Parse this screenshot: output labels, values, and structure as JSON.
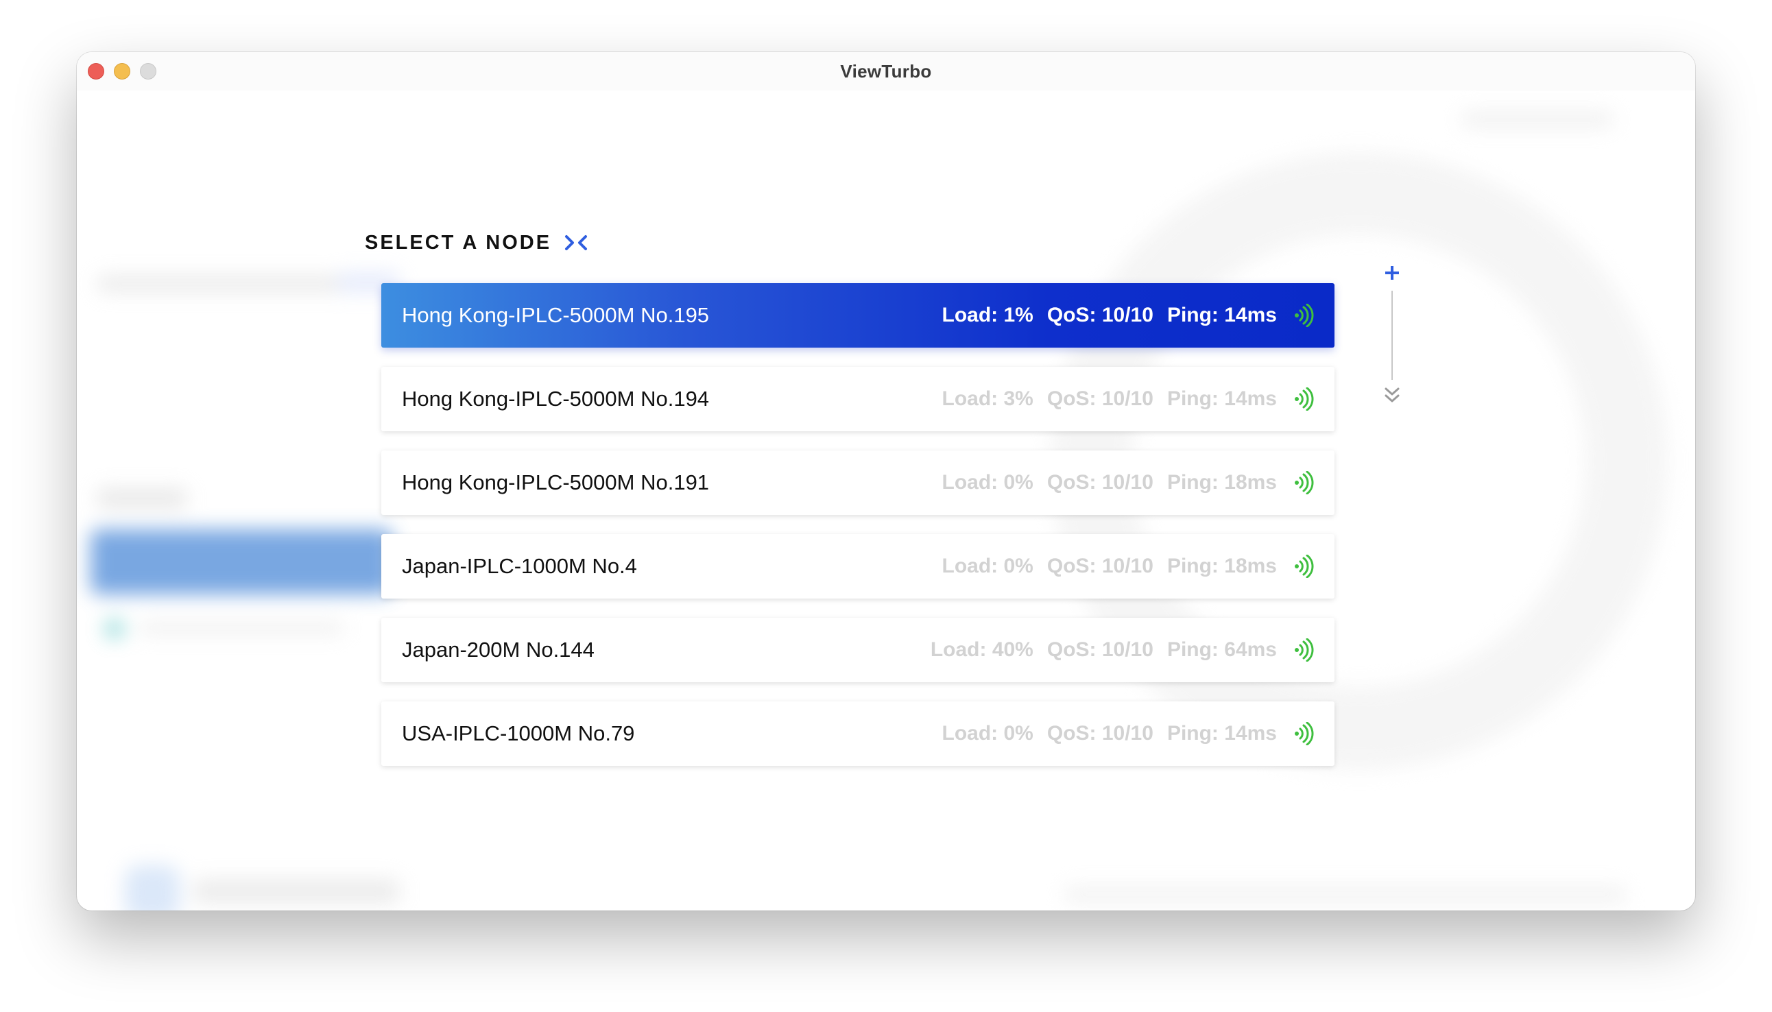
{
  "window": {
    "title": "ViewTurbo"
  },
  "panel": {
    "title": "SELECT A NODE",
    "collapse_icon": "collapse-arrows-icon"
  },
  "nodes": [
    {
      "name": "Hong Kong-IPLC-5000M No.195",
      "load": "Load: 1%",
      "qos": "QoS: 10/10",
      "ping": "Ping: 14ms",
      "selected": true
    },
    {
      "name": "Hong Kong-IPLC-5000M No.194",
      "load": "Load: 3%",
      "qos": "QoS: 10/10",
      "ping": "Ping: 14ms",
      "selected": false
    },
    {
      "name": "Hong Kong-IPLC-5000M No.191",
      "load": "Load: 0%",
      "qos": "QoS: 10/10",
      "ping": "Ping: 18ms",
      "selected": false
    },
    {
      "name": "Japan-IPLC-1000M No.4",
      "load": "Load: 0%",
      "qos": "QoS: 10/10",
      "ping": "Ping: 18ms",
      "selected": false
    },
    {
      "name": "Japan-200M No.144",
      "load": "Load: 40%",
      "qos": "QoS: 10/10",
      "ping": "Ping: 64ms",
      "selected": false
    },
    {
      "name": "USA-IPLC-1000M No.79",
      "load": "Load: 0%",
      "qos": "QoS: 10/10",
      "ping": "Ping: 14ms",
      "selected": false
    }
  ],
  "colors": {
    "accent": "#2f5ee0",
    "selected_gradient_start": "#3d8ee0",
    "selected_gradient_end": "#0a2ac8",
    "signal": "#3fbf3f",
    "stat_muted": "#d2d2d2"
  },
  "icons": {
    "signal": "signal-strength-icon",
    "plus": "plus-icon",
    "scroll_down": "chevron-double-down-icon"
  }
}
